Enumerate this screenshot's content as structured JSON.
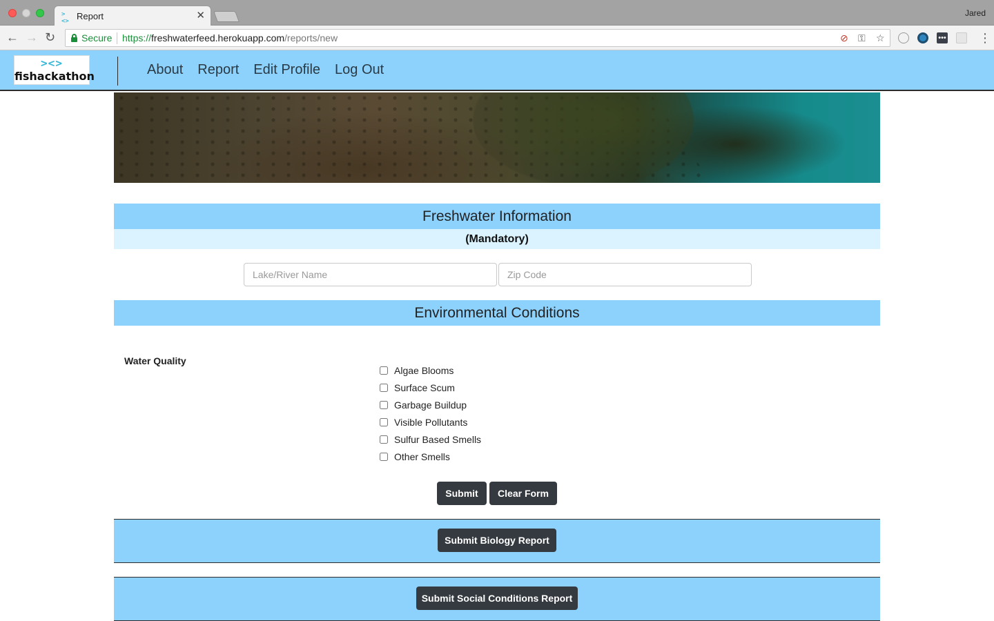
{
  "browser": {
    "tab_title": "Report",
    "tab_favicon": "><>",
    "profile_name": "Jared",
    "secure_label": "Secure",
    "url_scheme": "https://",
    "url_host": "freshwaterfeed.herokuapp.com",
    "url_path": "/reports/new",
    "icons": [
      "back-icon",
      "forward-icon",
      "reload-icon",
      "lock-icon",
      "blocked-icon",
      "key-icon",
      "star-icon",
      "extension-icons",
      "menu-icon"
    ]
  },
  "header": {
    "logo_mark": "><>",
    "logo_text": "fishackathon",
    "nav": [
      "About",
      "Report",
      "Edit Profile",
      "Log Out"
    ],
    "background": "#8dd1fd"
  },
  "form": {
    "freshwater_title": "Freshwater Information",
    "mandatory_label": "(Mandatory)",
    "lake_placeholder": "Lake/River Name",
    "zip_placeholder": "Zip Code",
    "environment_title": "Environmental Conditions",
    "water_quality_label": "Water Quality",
    "options": [
      "Algae Blooms",
      "Surface Scum",
      "Garbage Buildup",
      "Visible Pollutants",
      "Sulfur Based Smells",
      "Other Smells"
    ],
    "submit_label": "Submit",
    "clear_label": "Clear Form"
  },
  "reports": {
    "biology_label": "Submit Biology Report",
    "social_label": "Submit Social Conditions Report"
  },
  "colors": {
    "accent": "#8dd1fd",
    "accent_light": "#daf3fe",
    "button": "#343a40"
  }
}
